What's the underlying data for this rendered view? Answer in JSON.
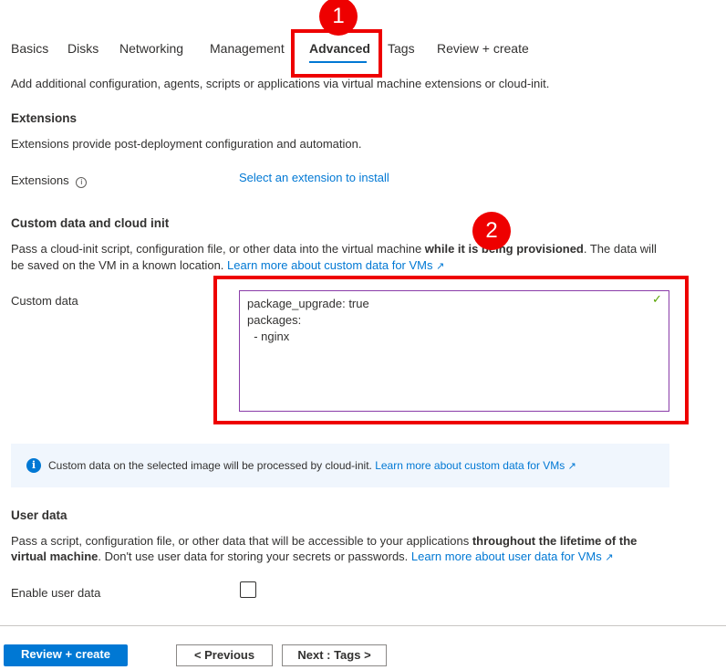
{
  "tabs": [
    "Basics",
    "Disks",
    "Networking",
    "Management",
    "Advanced",
    "Tags",
    "Review + create"
  ],
  "intro": "Add additional configuration, agents, scripts or applications via virtual machine extensions or cloud-init.",
  "extensions": {
    "heading": "Extensions",
    "desc": "Extensions provide post-deployment configuration and automation.",
    "label": "Extensions",
    "link": "Select an extension to install"
  },
  "custom": {
    "heading": "Custom data and cloud init",
    "desc_pre": "Pass a cloud-init script, configuration file, or other data into the virtual machine ",
    "desc_bold": "while it is being provisioned",
    "desc_post": ". The data will be saved on the VM in a known location. ",
    "link": "Learn more about custom data for VMs",
    "label": "Custom data",
    "value": "package_upgrade: true\npackages:\n  - nginx"
  },
  "info": {
    "text": "Custom data on the selected image will be processed by cloud-init. ",
    "link": "Learn more about custom data for VMs"
  },
  "user": {
    "heading": "User data",
    "desc_pre": "Pass a script, configuration file, or other data that will be accessible to your applications ",
    "desc_bold": "throughout the lifetime of the virtual machine",
    "desc_post": ". Don't use user data for storing your secrets or passwords. ",
    "link": "Learn more about user data for VMs",
    "label": "Enable user data"
  },
  "footer": {
    "review": "Review + create",
    "previous": "< Previous",
    "next": "Next : Tags >"
  },
  "annotations": [
    "1",
    "2"
  ]
}
